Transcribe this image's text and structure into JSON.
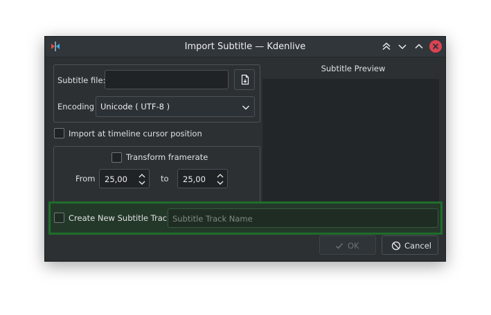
{
  "window": {
    "title": "Import Subtitle — Kdenlive",
    "app_icon": "kdenlive-icon",
    "controls": [
      "keep-above-icon",
      "minimize-icon",
      "maximize-icon",
      "close-icon"
    ]
  },
  "file": {
    "label": "Subtitle file:",
    "value": "",
    "browse_icon": "open-file-icon"
  },
  "encoding": {
    "label": "Encoding",
    "value": "Unicode ( UTF-8 )"
  },
  "import_cursor": {
    "label": "Import at timeline cursor position",
    "checked": false
  },
  "framerate": {
    "label": "Transform framerate",
    "checked": false,
    "from_label": "From",
    "from_value": "25,00",
    "to_label": "to",
    "to_value": "25,00"
  },
  "preview": {
    "title": "Subtitle Preview"
  },
  "new_track": {
    "label": "Create New Subtitle Track",
    "checked": false,
    "placeholder": "Subtitle Track Name"
  },
  "buttons": {
    "ok": "OK",
    "cancel": "Cancel"
  },
  "colors": {
    "window_bg": "#2c3033",
    "close_button": "#da4453",
    "highlight_border": "#1e6e2a"
  }
}
